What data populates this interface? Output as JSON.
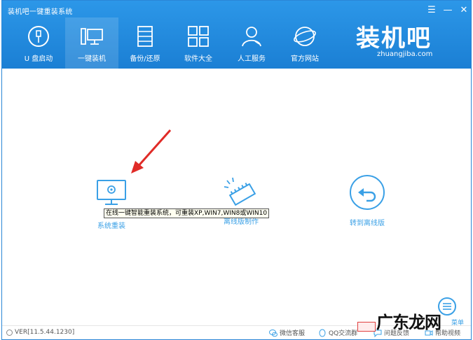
{
  "window": {
    "title": "装机吧一键重装系统",
    "menu_glyph": "☰",
    "min_glyph": "—",
    "close_glyph": "✕"
  },
  "nav": {
    "items": [
      {
        "label": "U 盘启动",
        "icon": "usb-icon"
      },
      {
        "label": "一键装机",
        "icon": "computer-icon"
      },
      {
        "label": "备份/还原",
        "icon": "backup-icon"
      },
      {
        "label": "软件大全",
        "icon": "apps-grid-icon"
      },
      {
        "label": "人工服务",
        "icon": "support-person-icon"
      },
      {
        "label": "官方网站",
        "icon": "globe-icon"
      }
    ],
    "active_index": 1
  },
  "logo": {
    "text": "装机吧",
    "subtext": "zhuangjiba.com"
  },
  "features": {
    "reinstall_label": "系统重装",
    "offline_label": "离线版制作",
    "switch_label": "转到离线版"
  },
  "tooltip": {
    "text": "在线一键智能重装系统，可重装XP,WIN7,WIN8或WIN10"
  },
  "side_menu": {
    "label": "菜单"
  },
  "footer": {
    "version": "VER[11.5.44.1230]",
    "links": [
      {
        "label": "微信客服",
        "icon": "wechat-icon"
      },
      {
        "label": "QQ交流群",
        "icon": "qq-icon"
      },
      {
        "label": "问题反馈",
        "icon": "feedback-icon"
      },
      {
        "label": "帮助视频",
        "icon": "video-icon"
      }
    ]
  },
  "watermark": {
    "text": "广东龙网"
  },
  "colors": {
    "header_blue": "#1b7fd4",
    "accent_blue": "#3aa0e6",
    "arrow_red": "#e02b27"
  }
}
